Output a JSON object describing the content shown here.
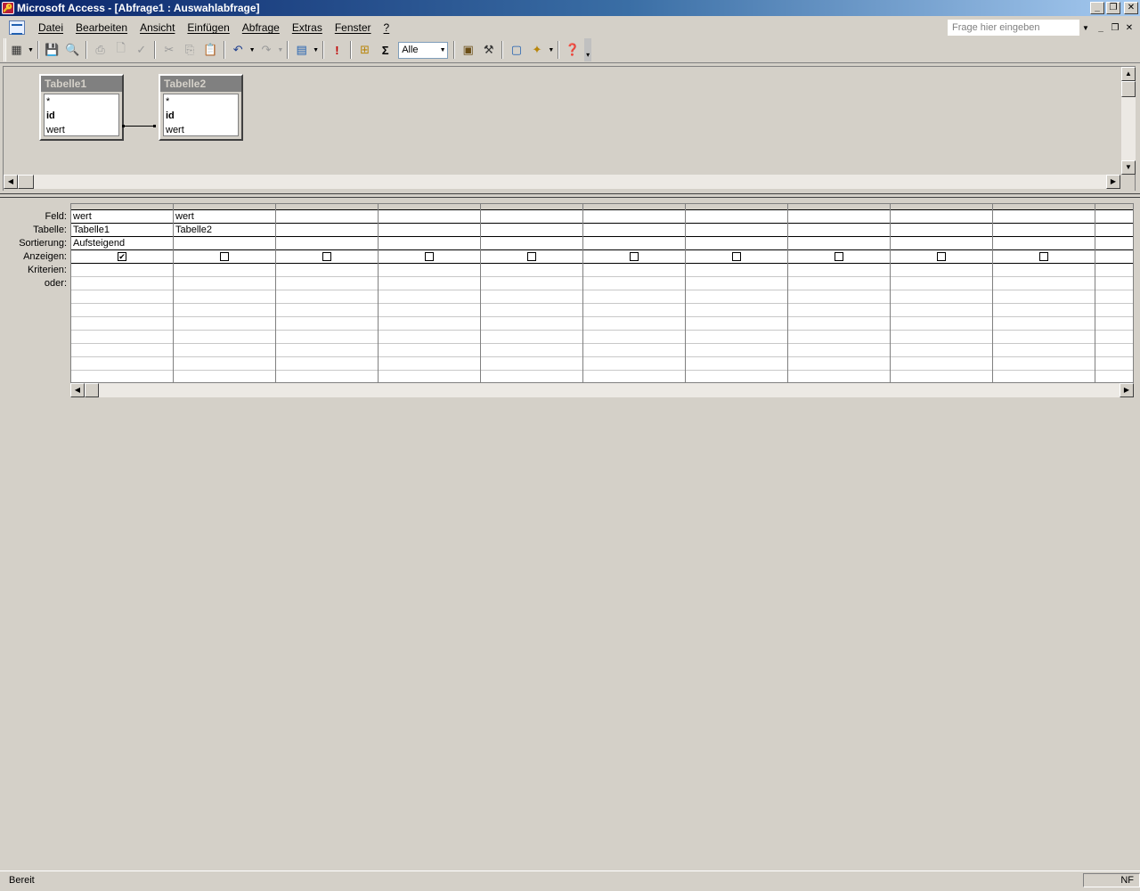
{
  "window": {
    "title": "Microsoft Access - [Abfrage1 : Auswahlabfrage]",
    "app_icon": "access-key-icon"
  },
  "menu": {
    "items": [
      "Datei",
      "Bearbeiten",
      "Ansicht",
      "Einfügen",
      "Abfrage",
      "Extras",
      "Fenster",
      "?"
    ],
    "ask_placeholder": "Frage hier eingeben"
  },
  "toolbar": {
    "top_values_combo": "Alle",
    "sum_symbol": "Σ",
    "run_symbol": "!"
  },
  "tables": [
    {
      "name": "Tabelle1",
      "fields": [
        "*",
        "id",
        "wert"
      ]
    },
    {
      "name": "Tabelle2",
      "fields": [
        "*",
        "id",
        "wert"
      ]
    }
  ],
  "grid": {
    "row_labels": [
      "Feld:",
      "Tabelle:",
      "Sortierung:",
      "Anzeigen:",
      "Kriterien:",
      "oder:"
    ],
    "columns": [
      {
        "feld": "wert",
        "tabelle": "Tabelle1",
        "sortierung": "Aufsteigend",
        "anzeigen": true
      },
      {
        "feld": "wert",
        "tabelle": "Tabelle2",
        "sortierung": "",
        "anzeigen": false
      },
      {
        "feld": "",
        "tabelle": "",
        "sortierung": "",
        "anzeigen": false
      },
      {
        "feld": "",
        "tabelle": "",
        "sortierung": "",
        "anzeigen": false
      },
      {
        "feld": "",
        "tabelle": "",
        "sortierung": "",
        "anzeigen": false
      },
      {
        "feld": "",
        "tabelle": "",
        "sortierung": "",
        "anzeigen": false
      },
      {
        "feld": "",
        "tabelle": "",
        "sortierung": "",
        "anzeigen": false
      },
      {
        "feld": "",
        "tabelle": "",
        "sortierung": "",
        "anzeigen": false
      },
      {
        "feld": "",
        "tabelle": "",
        "sortierung": "",
        "anzeigen": false
      },
      {
        "feld": "",
        "tabelle": "",
        "sortierung": "",
        "anzeigen": false
      },
      {
        "feld": "",
        "tabelle": "",
        "sortierung": "",
        "anzeigen": false
      }
    ]
  },
  "status": {
    "text": "Bereit",
    "indicator": "NF"
  }
}
